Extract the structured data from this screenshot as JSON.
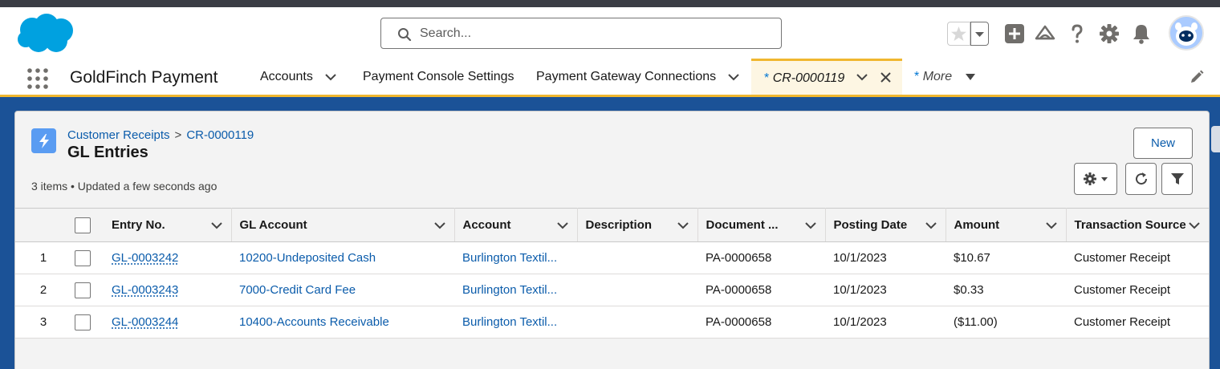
{
  "header": {
    "search_placeholder": "Search...",
    "icons": [
      "favorites-star-icon",
      "add-icon",
      "trailhead-icon",
      "help-icon",
      "setup-gear-icon",
      "notifications-bell-icon",
      "user-avatar"
    ]
  },
  "nav": {
    "app_name": "GoldFinch Payment",
    "items": [
      {
        "label": "Accounts",
        "has_dropdown": true
      },
      {
        "label": "Payment Console Settings",
        "has_dropdown": false
      },
      {
        "label": "Payment Gateway Connections",
        "has_dropdown": true
      }
    ],
    "active_tab": {
      "prefix": "*",
      "label": "CR-0000119"
    },
    "more": {
      "prefix": "*",
      "label": "More"
    }
  },
  "card": {
    "breadcrumb": [
      "Customer Receipts",
      "CR-0000119"
    ],
    "breadcrumb_sep": ">",
    "title": "GL Entries",
    "meta": "3 items • Updated a few seconds ago",
    "new_label": "New"
  },
  "table": {
    "columns": [
      "Entry No.",
      "GL Account",
      "Account",
      "Description",
      "Document ...",
      "Posting Date",
      "Amount",
      "Transaction Source"
    ],
    "rows": [
      {
        "num": "1",
        "entry": "GL-0003242",
        "gl_account": "10200-Undeposited Cash",
        "account": "Burlington Textil...",
        "description": "",
        "document": "PA-0000658",
        "posting_date": "10/1/2023",
        "amount": "$10.67",
        "source": "Customer Receipt"
      },
      {
        "num": "2",
        "entry": "GL-0003243",
        "gl_account": "7000-Credit Card Fee",
        "account": "Burlington Textil...",
        "description": "",
        "document": "PA-0000658",
        "posting_date": "10/1/2023",
        "amount": "$0.33",
        "source": "Customer Receipt"
      },
      {
        "num": "3",
        "entry": "GL-0003244",
        "gl_account": "10400-Accounts Receivable",
        "account": "Burlington Textil...",
        "description": "",
        "document": "PA-0000658",
        "posting_date": "10/1/2023",
        "amount": "($11.00)",
        "source": "Customer Receipt"
      }
    ]
  },
  "colors": {
    "brand": "#00a1e0",
    "link": "#0b5cab",
    "accent_tab": "#f0b72f",
    "background": "#1b5297"
  }
}
